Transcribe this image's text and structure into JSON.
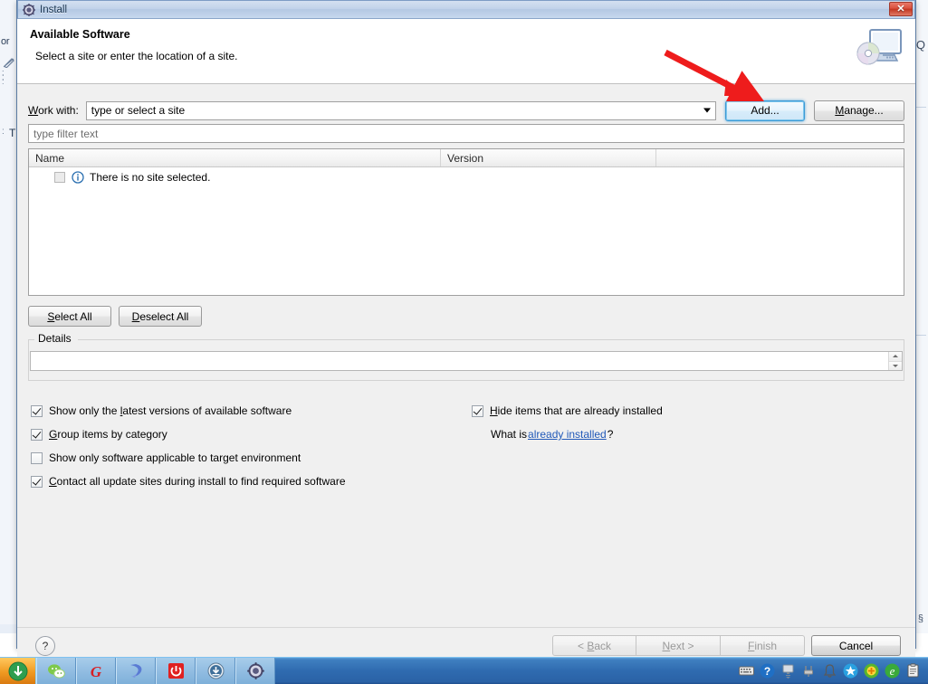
{
  "window": {
    "title": "Install",
    "title_icon": "eclipse-gear-icon",
    "close_label": "✕"
  },
  "header": {
    "title": "Available Software",
    "subtitle": "Select a site or enter the location of a site.",
    "icon": "computer-disc-icon"
  },
  "work_with": {
    "label_prefix": "W",
    "label_rest": "ork with:",
    "value": "type or select a site",
    "dropdown_icon": "chevron-down-icon",
    "add_label": "Add...",
    "manage_label_prefix": "M",
    "manage_label_rest": "anage..."
  },
  "filter": {
    "placeholder": "type filter text"
  },
  "table": {
    "columns": [
      "Name",
      "Version",
      ""
    ],
    "rows": [
      {
        "checked": false,
        "icon": "info-icon",
        "label": "There is no site selected."
      }
    ]
  },
  "selection_buttons": {
    "select_all_prefix": "S",
    "select_all_rest": "elect All",
    "deselect_all_prefix": "D",
    "deselect_all_rest": "eselect All"
  },
  "details": {
    "legend": "Details",
    "value": ""
  },
  "options": {
    "left": [
      {
        "checked": true,
        "pre": "Show only the ",
        "mn": "l",
        "post": "atest versions of available software"
      },
      {
        "checked": true,
        "pre": "",
        "mn": "G",
        "post": "roup items by category"
      },
      {
        "checked": false,
        "pre": "Show only software applicable to target environment",
        "mn": "",
        "post": ""
      },
      {
        "checked": true,
        "pre": "",
        "mn": "C",
        "post": "ontact all update sites during install to find required software"
      }
    ],
    "right": [
      {
        "checked": true,
        "pre": "",
        "mn": "H",
        "post": "ide items that are already installed"
      }
    ],
    "what_is_prefix": "What is ",
    "what_is_link": "already installed",
    "what_is_suffix": "?"
  },
  "footer": {
    "help_label": "?",
    "back_prefix": "< ",
    "back_mn": "B",
    "back_rest": "ack",
    "next_prefix": "",
    "next_mn": "N",
    "next_rest": "ext >",
    "finish_prefix": "",
    "finish_mn": "F",
    "finish_rest": "inish",
    "cancel_label": "Cancel"
  },
  "annotation": {
    "arrow_color": "#ee1c1c",
    "points_to": "add-button"
  },
  "background": {
    "left_tab_text": "or",
    "left_letter": "T",
    "right_letter": "Q"
  },
  "taskbar": {
    "start_icon": "start-orb-icon",
    "items": [
      {
        "icon": "wechat-icon"
      },
      {
        "icon": "gome-g-icon"
      },
      {
        "icon": "blue-swoosh-icon"
      },
      {
        "icon": "red-power-icon"
      },
      {
        "icon": "download-icon"
      },
      {
        "icon": "eclipse-gear-icon"
      }
    ],
    "tray": [
      {
        "icon": "keyboard-icon"
      },
      {
        "icon": "help-blue-icon"
      },
      {
        "icon": "monitor-icon"
      },
      {
        "icon": "plug-icon"
      },
      {
        "icon": "bell-icon"
      },
      {
        "icon": "blue-star-icon"
      },
      {
        "icon": "green-plus-icon"
      },
      {
        "icon": "browser-e-icon"
      },
      {
        "icon": "clipboard-icon"
      }
    ]
  },
  "colors": {
    "accent": "#2159b8",
    "annotation": "#ee1c1c",
    "titlebar": "#b4c8e3",
    "taskbar": "#2f6bb0"
  }
}
